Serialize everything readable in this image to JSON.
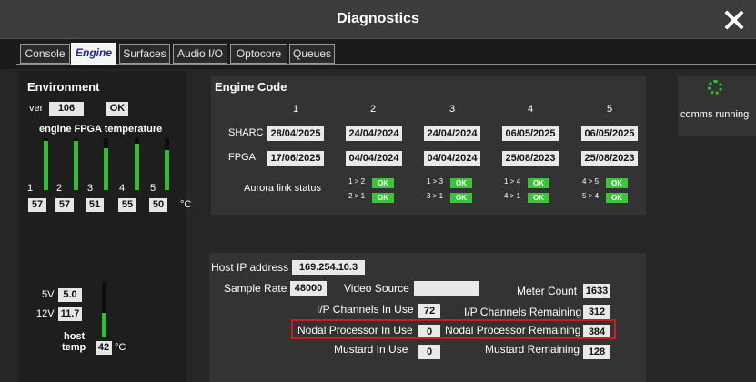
{
  "window": {
    "title": "Diagnostics",
    "close_icon": "close-icon"
  },
  "tabs": [
    {
      "label": "Console",
      "active": false
    },
    {
      "label": "Engine",
      "active": true
    },
    {
      "label": "Surfaces",
      "active": false
    },
    {
      "label": "Audio I/O",
      "active": false
    },
    {
      "label": "Optocore",
      "active": false
    },
    {
      "label": "Queues",
      "active": false
    }
  ],
  "environment": {
    "title": "Environment",
    "ver_label": "ver",
    "ver_value": "106",
    "ver_status": "OK",
    "fpga_title": "engine FPGA temperature",
    "fpga": [
      {
        "label": "1",
        "value": "57",
        "level": 0.95
      },
      {
        "label": "2",
        "value": "57",
        "level": 0.95
      },
      {
        "label": "3",
        "value": "51",
        "level": 0.8
      },
      {
        "label": "4",
        "value": "55",
        "level": 0.9
      },
      {
        "label": "5",
        "value": "50",
        "level": 0.78
      }
    ],
    "fpga_unit": "°C",
    "voltages": [
      {
        "label": "5V",
        "value": "5.0"
      },
      {
        "label": "12V",
        "value": "11.7"
      }
    ],
    "host_temp_label_1": "host",
    "host_temp_label_2": "temp",
    "host_temp_value": "42",
    "host_temp_level": 0.45,
    "host_temp_unit": "°C"
  },
  "engine_code": {
    "title": "Engine Code",
    "columns": [
      "1",
      "2",
      "3",
      "4",
      "5"
    ],
    "sharc_label": "SHARC",
    "sharc": [
      "28/04/2025",
      "24/04/2024",
      "24/04/2024",
      "06/05/2025",
      "06/05/2025"
    ],
    "fpga_label": "FPGA",
    "fpga": [
      "17/06/2025",
      "04/04/2024",
      "04/04/2024",
      "25/08/2023",
      "25/08/2023"
    ],
    "aurora_label": "Aurora link status",
    "links": [
      {
        "top": "1 > 2",
        "top_status": "OK",
        "bottom": "2 > 1",
        "bottom_status": "OK"
      },
      {
        "top": "1 > 3",
        "top_status": "OK",
        "bottom": "3 > 1",
        "bottom_status": "OK"
      },
      {
        "top": "1 > 4",
        "top_status": "OK",
        "bottom": "4 > 1",
        "bottom_status": "OK"
      },
      {
        "top": "4 > 5",
        "top_status": "OK",
        "bottom": "5 > 4",
        "bottom_status": "OK"
      }
    ]
  },
  "comms": {
    "status": "comms running",
    "icon": "spinner-icon"
  },
  "host": {
    "ip_label": "Host IP address",
    "ip_value": "169.254.10.3",
    "sample_rate_label": "Sample Rate",
    "sample_rate_value": "48000",
    "video_source_label": "Video Source",
    "video_source_value": "",
    "meter_count_label": "Meter Count",
    "meter_count_value": "1633",
    "ip_in_use_label": "I/P Channels In Use",
    "ip_in_use_value": "72",
    "ip_remaining_label": "I/P Channels Remaining",
    "ip_remaining_value": "312",
    "nodal_in_use_label": "Nodal Processor In Use",
    "nodal_in_use_value": "0",
    "nodal_remaining_label": "Nodal Processor Remaining",
    "nodal_remaining_value": "384",
    "mustard_in_use_label": "Mustard In Use",
    "mustard_in_use_value": "0",
    "mustard_remaining_label": "Mustard Remaining",
    "mustard_remaining_value": "128"
  },
  "colors": {
    "highlight": "#d11a1a",
    "ok_green": "#3cc43c",
    "bar_green": "#2fbf2f"
  }
}
